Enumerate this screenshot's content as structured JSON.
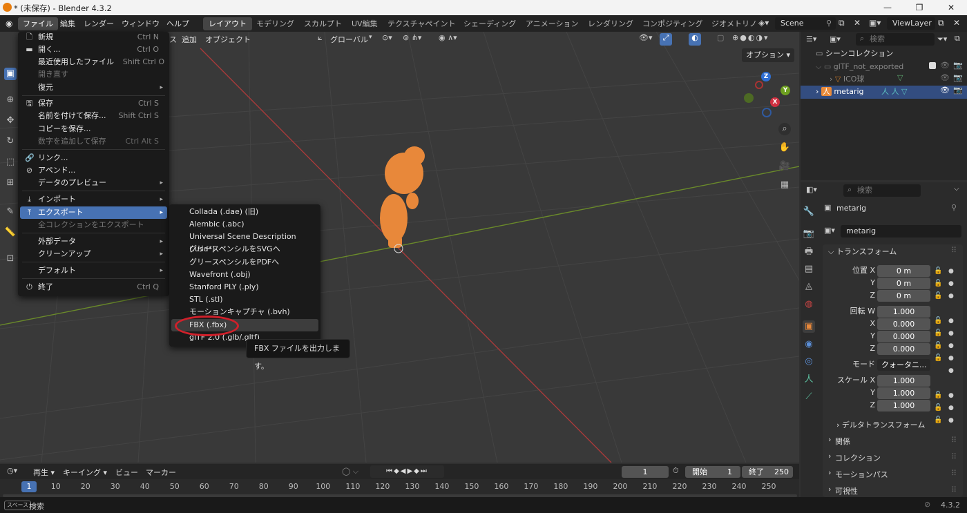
{
  "titlebar": {
    "title": "* (未保存) - Blender 4.3.2",
    "minimize": "—",
    "maximize": "❐",
    "close": "✕"
  },
  "menubar": {
    "menus": [
      "ファイル",
      "編集",
      "レンダー",
      "ウィンドウ",
      "ヘルプ"
    ],
    "tabs": [
      "レイアウト",
      "モデリング",
      "スカルプト",
      "UV編集",
      "テクスチャペイント",
      "シェーディング",
      "アニメーション",
      "レンダリング",
      "コンポジティング",
      "ジオメトリノ"
    ],
    "scene": "Scene",
    "viewlayer": "ViewLayer"
  },
  "viewport": {
    "menus": [
      "ス",
      "追加",
      "オブジェクト"
    ],
    "orientation": "グローバル",
    "options": "オプション"
  },
  "file_menu": [
    {
      "label": "新規",
      "shortcut": "Ctrl N",
      "icon": "new-file-icon"
    },
    {
      "label": "開く...",
      "shortcut": "Ctrl O",
      "icon": "folder-open-icon"
    },
    {
      "label": "最近使用したファイル",
      "shortcut": "Shift Ctrl O"
    },
    {
      "label": "開き直す"
    },
    {
      "label": "復元"
    },
    {
      "label": "保存",
      "shortcut": "Ctrl S"
    },
    {
      "label": "名前を付けて保存...",
      "shortcut": "Shift Ctrl S"
    },
    {
      "label": "コピーを保存..."
    },
    {
      "label": "数字を追加して保存",
      "shortcut": "Ctrl Alt S"
    },
    {
      "label": "リンク..."
    },
    {
      "label": "アペンド..."
    },
    {
      "label": "データのプレビュー"
    },
    {
      "label": "インポート"
    },
    {
      "label": "エクスポート"
    },
    {
      "label": "全コレクションをエクスポート"
    },
    {
      "label": "外部データ"
    },
    {
      "label": "クリーンアップ"
    },
    {
      "label": "デフォルト"
    },
    {
      "label": "終了",
      "shortcut": "Ctrl Q"
    }
  ],
  "export_menu": [
    "Collada (.dae) (旧)",
    "Alembic (.abc)",
    "Universal Scene Description (.usd*)",
    "グリースペンシルをSVGへ",
    "グリースペンシルをPDFへ",
    "Wavefront (.obj)",
    "Stanford PLY (.ply)",
    "STL (.stl)",
    "モーションキャプチャ (.bvh)",
    "FBX (.fbx)",
    "glTF 2.0 (.glb/.gltf)"
  ],
  "tooltip": "FBX ファイルを出力します。",
  "outliner": {
    "search": "検索",
    "scene_collection": "シーンコレクション",
    "items": [
      "glTF_not_exported",
      "ICO球",
      "metarig"
    ]
  },
  "properties": {
    "search": "検索",
    "object_name": "metarig",
    "data_name": "metarig",
    "transform_header": "トランスフォーム",
    "location_label": "位置 X",
    "rotation_label": "回転 W",
    "mode_label": "モード",
    "mode_value": "クォータニ...",
    "scale_label": "スケール X",
    "y": "Y",
    "z": "Z",
    "x": "X",
    "loc": [
      "0 m",
      "0 m",
      "0 m"
    ],
    "rot": [
      "1.000",
      "0.000",
      "0.000",
      "0.000"
    ],
    "scale": [
      "1.000",
      "1.000",
      "1.000"
    ],
    "sections": [
      "デルタトランスフォーム",
      "関係",
      "コレクション",
      "モーションパス",
      "可視性"
    ]
  },
  "timeline": {
    "menus": [
      "再生",
      "キーイング",
      "ビュー",
      "マーカー"
    ],
    "current_frame": "1",
    "start_label": "開始",
    "start": "1",
    "end_label": "終了",
    "end": "250",
    "ticks": [
      "1",
      "10",
      "20",
      "30",
      "40",
      "50",
      "60",
      "70",
      "80",
      "90",
      "100",
      "110",
      "120",
      "130",
      "140",
      "150",
      "160",
      "170",
      "180",
      "190",
      "200",
      "210",
      "220",
      "230",
      "240",
      "250"
    ]
  },
  "statusbar": {
    "key": "スペース",
    "action": "検索",
    "version": "4.3.2"
  },
  "colors": {
    "accent": "#4772b3",
    "highlight_circle": "#d0202a",
    "object_orange": "#e8883a"
  }
}
